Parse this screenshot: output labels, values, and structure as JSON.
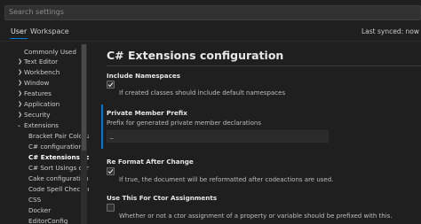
{
  "search": {
    "placeholder": "Search settings"
  },
  "tabs": [
    {
      "label": "User"
    },
    {
      "label": "Workspace"
    }
  ],
  "sync_status": "Last synced: now",
  "toc": {
    "items": [
      {
        "label": "Commonly Used",
        "chevron": ""
      },
      {
        "label": "Text Editor",
        "chevron": "right"
      },
      {
        "label": "Workbench",
        "chevron": "right"
      },
      {
        "label": "Window",
        "chevron": "right"
      },
      {
        "label": "Features",
        "chevron": "right"
      },
      {
        "label": "Application",
        "chevron": "right"
      },
      {
        "label": "Security",
        "chevron": "right"
      },
      {
        "label": "Extensions",
        "chevron": "down"
      },
      {
        "label": "Bracket Pair Coloriz...",
        "chevron": ""
      },
      {
        "label": "C# configuration",
        "chevron": ""
      },
      {
        "label": "C# Extensions con...",
        "chevron": "",
        "active": true
      },
      {
        "label": "C# Sort Usings con...",
        "chevron": ""
      },
      {
        "label": "Cake configuration",
        "chevron": ""
      },
      {
        "label": "Code Spell Checker",
        "chevron": ""
      },
      {
        "label": "CSS",
        "chevron": ""
      },
      {
        "label": "Docker",
        "chevron": ""
      },
      {
        "label": "EditorConfig",
        "chevron": ""
      }
    ]
  },
  "main": {
    "title": "C# Extensions configuration",
    "settings": [
      {
        "name": "Include Namespaces",
        "description": "If created classes should include default namespaces",
        "checked": true
      },
      {
        "name": "Private Member Prefix",
        "description": "Prefix for generated private member declarations",
        "value": "_"
      },
      {
        "name": "Re Format After Change",
        "description": "If true, the document will be reformatted after codeactions are used.",
        "checked": true
      },
      {
        "name": "Use This For Ctor Assignments",
        "description": "Whether or not a ctor assignment of a property or variable should be prefixed with this.",
        "checked": false
      }
    ]
  },
  "colors": {
    "accent": "#0078d4",
    "background": "#1f1f1f"
  }
}
